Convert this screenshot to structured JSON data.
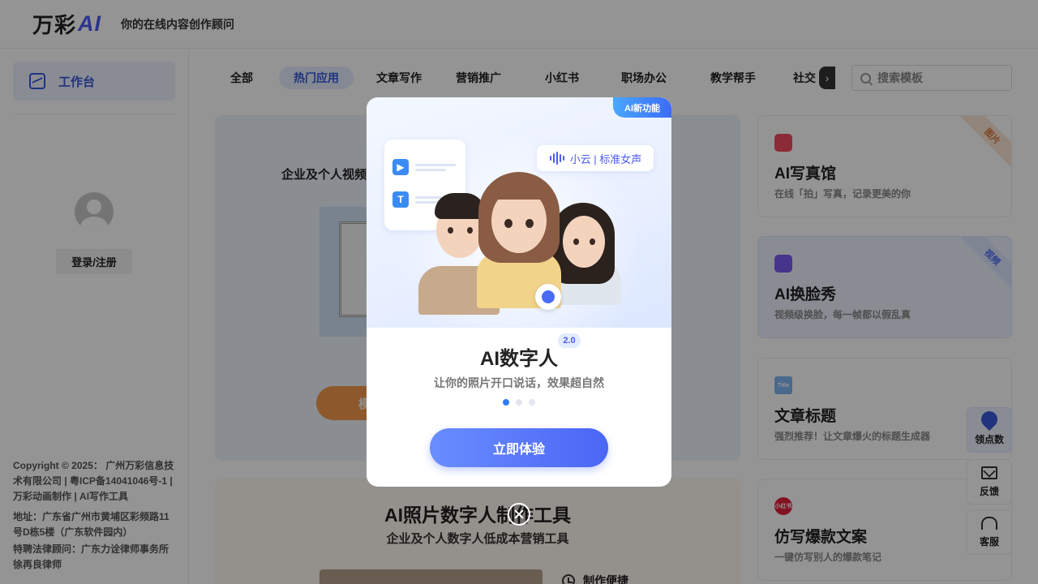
{
  "header": {
    "logo_text": "万彩",
    "logo_ai": "AI",
    "slogan": "你的在线内容创作顾问"
  },
  "sidebar": {
    "workbench_label": "工作台",
    "login_label": "登录/注册",
    "copyright": "Copyright © 2025： 广州万彩信息技术有限公司 | 粤ICP备14041046号-1 | 万彩动画制作 | AI写作工具",
    "address": "地址：广东省广州市黄埔区彩频路11号D栋5楼（广东软件园内）",
    "legal": "特聘法律顾问：广东力诠律师事务所 徐再良律师"
  },
  "tabs": [
    {
      "label": "全部",
      "active": false
    },
    {
      "label": "热门应用",
      "active": true
    },
    {
      "label": "文章写作",
      "active": false
    },
    {
      "label": "营销推广",
      "active": false
    },
    {
      "label": "小红书",
      "active": false
    },
    {
      "label": "职场办公",
      "active": false
    },
    {
      "label": "教学帮手",
      "active": false
    },
    {
      "label": "社交",
      "active": false
    }
  ],
  "search": {
    "placeholder": "搜索模板"
  },
  "main_cards": {
    "card1_subtitle": "企业及个人视频",
    "card1_button": "模",
    "card2_title": "AI照片数字人制作工具",
    "card2_subtitle": "企业及个人数字人低成本营销工具",
    "card2_feature": "制作便捷"
  },
  "right_cards": [
    {
      "title": "AI写真馆",
      "desc": "在线「拍」写真，记录更美的你",
      "ribbon": "图片",
      "icon": "camera-icon",
      "icon_color": "#ef4b5c",
      "ribbon_bg": "#fbe6d4",
      "ribbon_color": "#d9783a"
    },
    {
      "title": "AI换脸秀",
      "desc": "视频级换脸，每一帧都以假乱真",
      "ribbon": "视频",
      "icon": "face-swap-icon",
      "icon_color": "#7b5cf0",
      "ribbon_bg": "#dce5ff",
      "ribbon_color": "#4a6cf5"
    },
    {
      "title": "文章标题",
      "desc": "强烈推荐！让文章爆火的标题生成器",
      "ribbon": "",
      "icon": "title-icon",
      "icon_color": "#7fb5f2",
      "icon_text": "Title"
    },
    {
      "title": "仿写爆款文案",
      "desc": "一键仿写别人的爆款笔记",
      "ribbon": "",
      "icon": "xiaohongshu-icon",
      "icon_color": "#e0203a",
      "icon_text": "小红书"
    }
  ],
  "float_tools": {
    "points": "领点数",
    "feedback": "反馈",
    "service": "客服"
  },
  "modal": {
    "new_badge": "AI新功能",
    "voice_tag": "小云 | 标准女声",
    "version": "2.0",
    "title": "AI数字人",
    "description": "让你的照片开口说话，效果超自然",
    "cta": "立即体验",
    "slide_total": 3,
    "slide_active": 1
  },
  "colors": {
    "accent": "#3759d6",
    "cta_start": "#6a8dff",
    "cta_end": "#4a66f5",
    "overlay": "rgba(0,0,0,0.42)"
  }
}
